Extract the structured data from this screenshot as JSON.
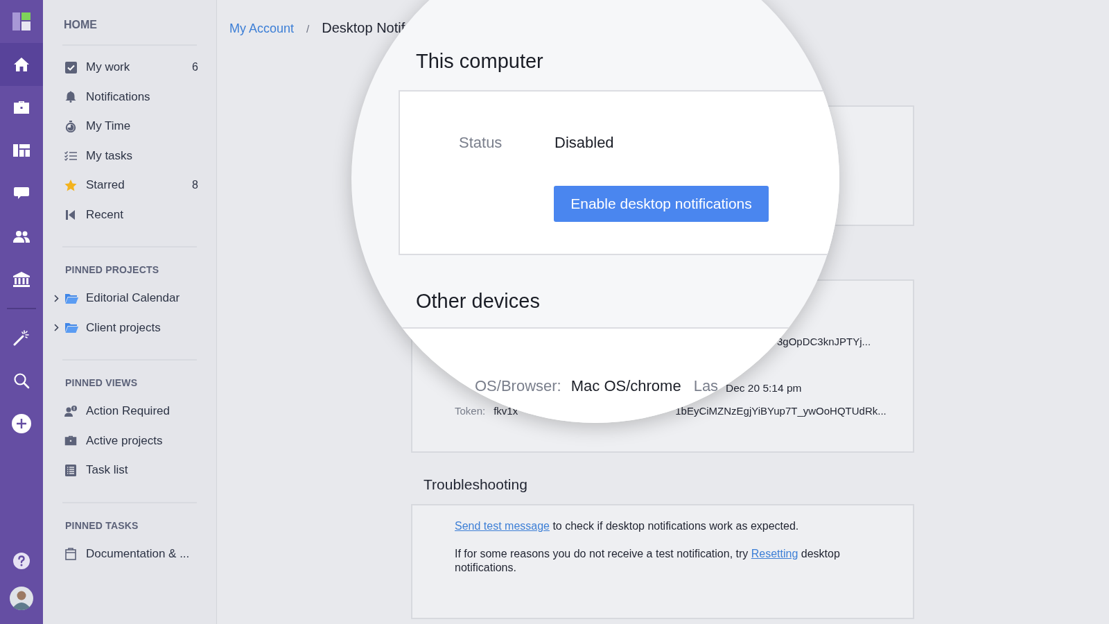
{
  "rail": {
    "logo": {
      "kind": "logo"
    },
    "items": [
      {
        "kind": "home",
        "selected": true
      },
      {
        "kind": "briefcase",
        "selected": false
      },
      {
        "kind": "board",
        "selected": false
      },
      {
        "kind": "chat",
        "selected": false
      },
      {
        "kind": "people",
        "selected": false
      },
      {
        "kind": "bank",
        "selected": false
      }
    ],
    "tools": [
      {
        "kind": "wand",
        "selected": false
      },
      {
        "kind": "search",
        "selected": false
      },
      {
        "kind": "plus",
        "selected": false
      }
    ],
    "bottom": [
      {
        "kind": "help"
      },
      {
        "kind": "avatar"
      }
    ]
  },
  "sidebar": {
    "title": "HOME",
    "items": [
      {
        "kind": "check",
        "label": "My work",
        "count": "6"
      },
      {
        "kind": "bell",
        "label": "Notifications"
      },
      {
        "kind": "timer",
        "label": "My Time"
      },
      {
        "kind": "tasks",
        "label": "My tasks"
      },
      {
        "kind": "star",
        "label": "Starred",
        "count": "8"
      },
      {
        "kind": "recent",
        "label": "Recent"
      }
    ],
    "sections": [
      {
        "title": "PINNED PROJECTS",
        "items": [
          {
            "kind": "folder",
            "label": "Editorial Calendar"
          },
          {
            "kind": "folder",
            "label": "Client projects"
          }
        ]
      },
      {
        "title": "PINNED VIEWS",
        "items": [
          {
            "kind": "person-alert",
            "label": "Action Required"
          },
          {
            "kind": "briefcase",
            "label": "Active projects"
          },
          {
            "kind": "list",
            "label": "Task list"
          }
        ]
      },
      {
        "title": "PINNED TASKS",
        "items": [
          {
            "kind": "clipboard",
            "label": "Documentation & ..."
          }
        ]
      }
    ]
  },
  "breadcrumb": {
    "parent_link": "My Account",
    "separator": "/",
    "current": "Desktop Notif"
  },
  "devices_card": {
    "token_1": "3gOpDC3knJPTYj...",
    "last_seen": "Dec 20 5:14 pm",
    "token_label": "Token:",
    "token_2_start": "fkv1x",
    "token_2_end": "1bEyCiMZNzEgjYiBYup7T_ywOoHQTUdRk..."
  },
  "troubleshooting": {
    "title": "Troubleshooting",
    "paragraphs": [
      {
        "link": "Send test message",
        "after": " to check if desktop notifications work as expected."
      },
      {
        "before": "If for some reasons you do not receive a test notification, try ",
        "link": "Resetting",
        "after": " desktop notifications."
      }
    ]
  },
  "magnifier": {
    "this_computer": {
      "title": "This computer",
      "status_label": "Status",
      "status_value": "Disabled",
      "button": "Enable desktop notifications"
    },
    "other_devices": {
      "title": "Other devices",
      "os_label": "OS/Browser:",
      "os_value": "Mac OS/chrome",
      "last_label": "Las"
    }
  }
}
